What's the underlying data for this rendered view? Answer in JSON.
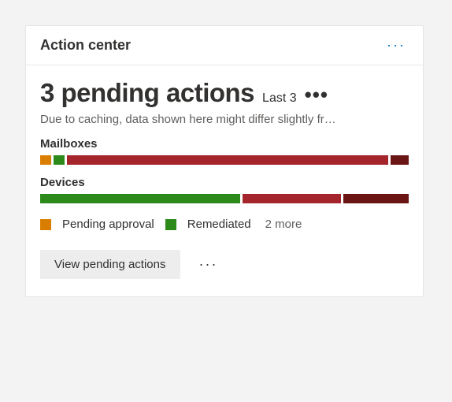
{
  "header": {
    "title": "Action center"
  },
  "main": {
    "headline": "3 pending actions",
    "headline_suffix": "Last 3",
    "caption": "Due to caching, data shown here might differ slightly fr…"
  },
  "colors": {
    "pending": "#d97e00",
    "remediated": "#2b8a1a",
    "failed": "#a4262c",
    "other": "#6b1414"
  },
  "groups": [
    {
      "label": "Mailboxes",
      "segments": [
        {
          "colorKey": "pending",
          "value": 3
        },
        {
          "colorKey": "remediated",
          "value": 3
        },
        {
          "colorKey": "failed",
          "value": 89
        },
        {
          "colorKey": "other",
          "value": 5
        }
      ]
    },
    {
      "label": "Devices",
      "segments": [
        {
          "colorKey": "remediated",
          "value": 55
        },
        {
          "colorKey": "failed",
          "value": 27
        },
        {
          "colorKey": "other",
          "value": 18
        }
      ]
    }
  ],
  "legend": {
    "items": [
      {
        "colorKey": "pending",
        "label": "Pending approval"
      },
      {
        "colorKey": "remediated",
        "label": "Remediated"
      }
    ],
    "more_label": "2 more"
  },
  "footer": {
    "button_label": "View pending actions"
  }
}
